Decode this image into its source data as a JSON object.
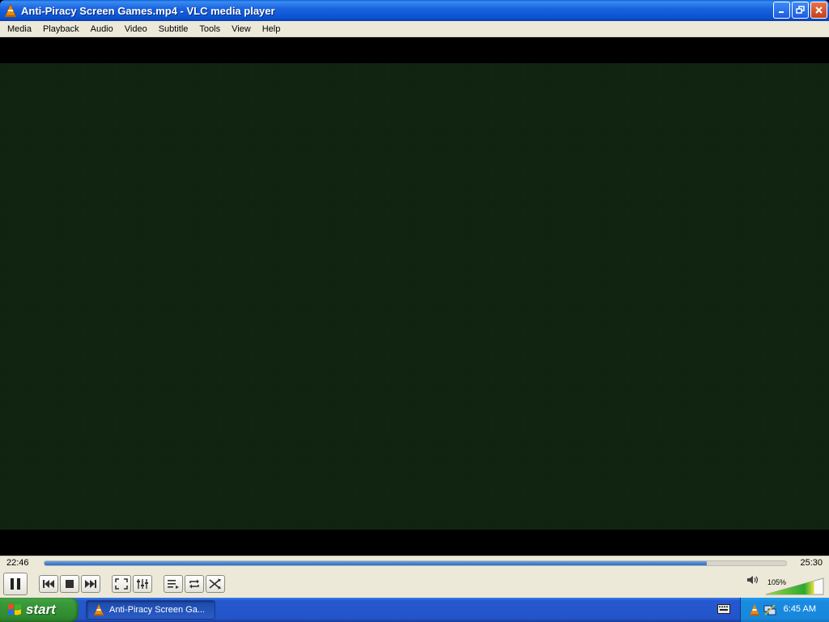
{
  "window": {
    "title": "Anti-Piracy Screen Games.mp4 - VLC media player",
    "buttons": [
      "minimize-icon",
      "restore-icon",
      "close-icon"
    ]
  },
  "menu": {
    "items": [
      "Media",
      "Playback",
      "Audio",
      "Video",
      "Subtitle",
      "Tools",
      "View",
      "Help"
    ]
  },
  "player": {
    "elapsed": "22:46",
    "total": "25:30",
    "progress": 0.893,
    "volume_label": "105%",
    "volume": 1.05,
    "controls": [
      "pause-icon",
      "previous-icon",
      "stop-icon",
      "next-icon",
      "fullscreen-icon",
      "extended-settings-icon",
      "playlist-icon",
      "loop-icon",
      "shuffle-icon"
    ]
  },
  "taskbar": {
    "start_label": "start",
    "task_label": "Anti-Piracy Screen Ga...",
    "clock": "6:45 AM"
  },
  "colors": {
    "video_tint": "#112411",
    "titlebar": "#0a52d0",
    "taskbar": "#2454c8",
    "start": "#3a9a3a",
    "seek_fill": "#2c6cc4",
    "vlc_orange": "#f08a00"
  }
}
